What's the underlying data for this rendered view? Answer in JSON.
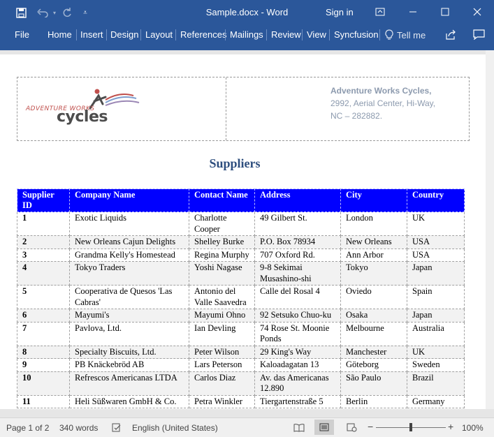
{
  "titlebar": {
    "save_icon": "save-icon",
    "undo_icon": "undo-icon",
    "redo_icon": "redo-icon",
    "customize_icon": "customize-quick-access-icon",
    "doc_title": "Sample.docx  -  Word",
    "signin_label": "Sign in",
    "ribbon_display_icon": "ribbon-display-options-icon",
    "minimize_icon": "minimize-icon",
    "maximize_icon": "maximize-icon",
    "close_icon": "close-icon"
  },
  "ribbon": {
    "tabs": [
      "File",
      "Home",
      "Insert",
      "Design",
      "Layout",
      "References",
      "Mailings",
      "Review",
      "View",
      "Syncfusion"
    ],
    "tell_me": "Tell me",
    "share_icon": "share-icon",
    "comments_icon": "comments-icon"
  },
  "document": {
    "logo": {
      "small_text": "ADVENTURE WORKS",
      "big_text": "cycles"
    },
    "address": [
      "Adventure Works Cycles,",
      "2992, Aerial Center, Hi-Way,",
      "NC – 282882."
    ],
    "heading": "Suppliers",
    "table": {
      "columns": [
        "Supplier ID",
        "Company Name",
        "Contact Name",
        "Address",
        "City",
        "Country"
      ],
      "rows": [
        [
          "1",
          "Exotic Liquids",
          "Charlotte Cooper",
          "49 Gilbert St.",
          "London",
          "UK"
        ],
        [
          "2",
          "New Orleans Cajun Delights",
          "Shelley Burke",
          "P.O. Box 78934",
          "New Orleans",
          "USA"
        ],
        [
          "3",
          "Grandma Kelly's Homestead",
          "Regina Murphy",
          "707 Oxford Rd.",
          "Ann Arbor",
          "USA"
        ],
        [
          "4",
          "Tokyo Traders",
          "Yoshi Nagase",
          "9-8 Sekimai Musashino-shi",
          "Tokyo",
          "Japan"
        ],
        [
          "5",
          "Cooperativa de Quesos 'Las Cabras'",
          "Antonio del Valle Saavedra",
          "Calle del Rosal 4",
          "Oviedo",
          "Spain"
        ],
        [
          "6",
          "Mayumi's",
          "Mayumi Ohno",
          "92 Setsuko Chuo-ku",
          "Osaka",
          "Japan"
        ],
        [
          "7",
          "Pavlova, Ltd.",
          "Ian Devling",
          "74 Rose St. Moonie Ponds",
          "Melbourne",
          "Australia"
        ],
        [
          "8",
          "Specialty Biscuits, Ltd.",
          "Peter Wilson",
          "29 King's Way",
          "Manchester",
          "UK"
        ],
        [
          "9",
          "PB Knäckebröd AB",
          "Lars Peterson",
          "Kaloadagatan 13",
          "Göteborg",
          "Sweden"
        ],
        [
          "10",
          "Refrescos Americanas LTDA",
          "Carlos Diaz",
          "Av. das Americanas 12.890",
          "São Paulo",
          "Brazil"
        ],
        [
          "11",
          "Heli Süßwaren GmbH & Co.",
          "Petra Winkler",
          "Tiergartenstraße 5",
          "Berlin",
          "Germany"
        ]
      ]
    }
  },
  "statusbar": {
    "page": "Page 1 of 2",
    "words": "340 words",
    "language": "English (United States)",
    "zoom": "100%",
    "read_mode_icon": "read-mode-icon",
    "print_layout_icon": "print-layout-icon",
    "web_layout_icon": "web-layout-icon"
  }
}
